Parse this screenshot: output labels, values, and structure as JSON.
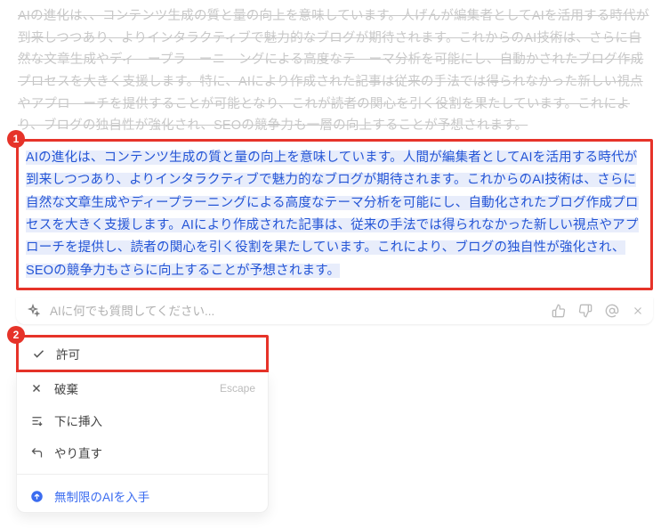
{
  "original_text": "AIの進化は、、コンテンツ生成の質と量の向上を意味しています。人げんが編集者としてAIを活用する時代が到来しつつあり、よりインタラクティブで魅力的なブログが期待されます。これからのAI技術は、さらに自然な文章生成やディ　ープラ　ーニ　ングによる高度なテ　ーマ分析を可能にし、自動かされたブログ作成プロセスを大きく支援します。特に、AIにより作成された記事は従来の手法では得られなかった新しい視点やアプロ　ーチを提供することが可能となり、これが読者の関心を引く役割を果たしています。これにより、ブログの独自性が強化され、SEOの競争力も一層の向上することが予想されます。",
  "suggestion_text": "AIの進化は、コンテンツ生成の質と量の向上を意味しています。人間が編集者としてAIを活用する時代が到来しつつあり、よりインタラクティブで魅力的なブログが期待されます。これからのAI技術は、さらに自然な文章生成やディープラーニングによる高度なテーマ分析を可能にし、自動化されたブログ作成プロセスを大きく支援します。AIにより作成された記事は、従来の手法では得られなかった新しい視点やアプローチを提供し、読者の関心を引く役割を果たしています。これにより、ブログの独自性が強化され、SEOの競争力もさらに向上することが予想されます。",
  "badges": {
    "one": "1",
    "two": "2"
  },
  "input": {
    "placeholder": "AIに何でも質問してください..."
  },
  "menu": {
    "accept": "許可",
    "discard": "破棄",
    "discard_shortcut": "Escape",
    "insert_below": "下に挿入",
    "retry": "やり直す",
    "upgrade": "無制限のAIを入手"
  }
}
